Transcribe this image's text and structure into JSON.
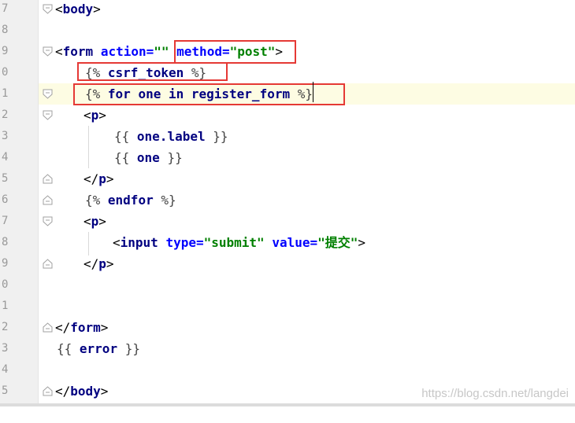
{
  "editor": {
    "line_numbers": [
      "7",
      "8",
      "9",
      "0",
      "1",
      "2",
      "3",
      "4",
      "5",
      "6",
      "7",
      "8",
      "9",
      "0",
      "1",
      "2",
      "3",
      "4",
      "5"
    ],
    "lines": {
      "l7_open": "<",
      "l7_tag": "body",
      "l7_close": ">",
      "l9_open": "<",
      "l9_tag": "form",
      "l9_attr1": "action=",
      "l9_val1": "\"\"",
      "l9_attr2": "method=",
      "l9_val2": "\"post\"",
      "l9_close": ">",
      "l10_b1": "{%",
      "l10_kw": "csrf_token",
      "l10_b2": "%}",
      "l11_b1": "{%",
      "l11_kw": "for one in register_form",
      "l11_b2": "%}",
      "l12_open": "<",
      "l12_tag": "p",
      "l12_close": ">",
      "l13_b1": "{{",
      "l13_var": "one.label",
      "l13_b2": "}}",
      "l14_b1": "{{",
      "l14_var": "one",
      "l14_b2": "}}",
      "l15_open": "</",
      "l15_tag": "p",
      "l15_close": ">",
      "l16_b1": "{%",
      "l16_kw": "endfor",
      "l16_b2": "%}",
      "l17_open": "<",
      "l17_tag": "p",
      "l17_close": ">",
      "l18_open": "<",
      "l18_tag": "input",
      "l18_attr1": "type=",
      "l18_val1": "\"submit\"",
      "l18_attr2": "value=",
      "l18_val2": "\"提交\"",
      "l18_close": ">",
      "l19_open": "</",
      "l19_tag": "p",
      "l19_close": ">",
      "l22_open": "</",
      "l22_tag": "form",
      "l22_close": ">",
      "l23_b1": "{{",
      "l23_var": "error",
      "l23_b2": "}}",
      "l25_open": "</",
      "l25_tag": "body",
      "l25_close": ">"
    }
  },
  "colors": {
    "highlight": "#e53935",
    "tag": "#000080",
    "attr": "#0000ff",
    "string": "#008000",
    "caret_line": "#fdfce3"
  },
  "watermark": "https://blog.csdn.net/langdei"
}
